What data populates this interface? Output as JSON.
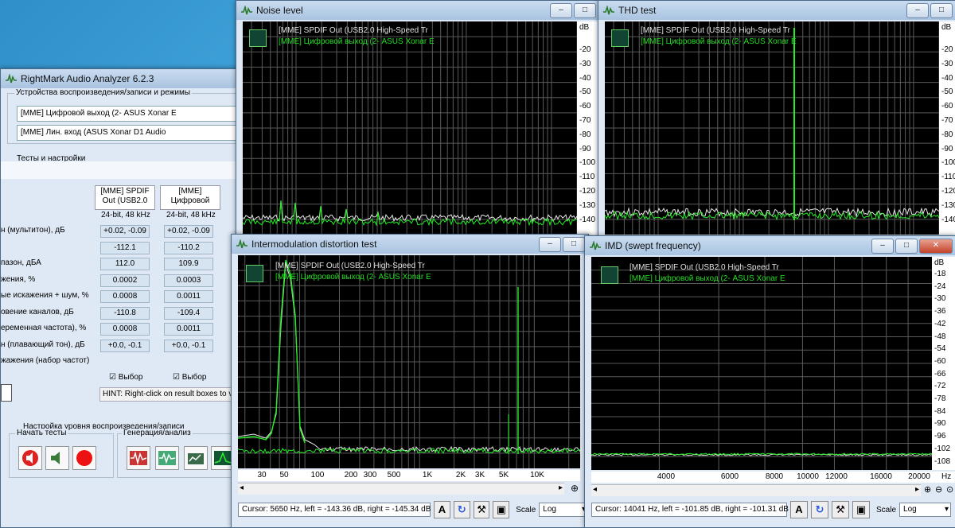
{
  "main": {
    "title": "RightMark Audio Analyzer 6.2.3",
    "devices_group": "Устройства воспроизведения/записи и режимы",
    "device_play": "[MME] Цифровой выход (2- ASUS Xonar E",
    "device_rec": "[MME] Лин. вход (ASUS Xonar D1 Audio",
    "tests_group": "Тесты и настройки",
    "col1_header": "[MME] SPDIF Out (USB2.0",
    "col2_header": "[MME] Цифровой",
    "col1_fmt": "24-bit, 48 kHz",
    "col2_fmt": "24-bit, 48 kHz",
    "rows": [
      {
        "label": "н (мультитон), дБ",
        "v1": "+0.02, -0.09",
        "v2": "+0.02, -0.09"
      },
      {
        "label": "",
        "v1": "-112.1",
        "v2": "-110.2"
      },
      {
        "label": "пазон, дБА",
        "v1": "112.0",
        "v2": "109.9"
      },
      {
        "label": "жения, %",
        "v1": "0.0002",
        "v2": "0.0003"
      },
      {
        "label": "ые искажения + шум, %",
        "v1": "0.0008",
        "v2": "0.0011"
      },
      {
        "label": "овение каналов, дБ",
        "v1": "-110.8",
        "v2": "-109.4"
      },
      {
        "label": "еременная частота), %",
        "v1": "0.0008",
        "v2": "0.0011"
      },
      {
        "label": "н (плавающий тон), дБ",
        "v1": "+0.0, -0.1",
        "v2": "+0.0, -0.1"
      },
      {
        "label": "жажения (набор частот)",
        "v1": "",
        "v2": ""
      }
    ],
    "select_label": "Выбор",
    "hint": "HINT: Right-click on result boxes to vi",
    "level_setup": "Настройка уровня воспроизведения/записи",
    "start_group": "Начать тесты",
    "gen_group": "Генерация/анализ"
  },
  "legend_line1": "[MME] SPDIF Out (USB2.0 High-Speed Tr",
  "legend_line2": "[MME] Цифровой выход (2- ASUS Xonar E",
  "noise": {
    "title": "Noise level",
    "db_label": "dB",
    "db_ticks": [
      "-20",
      "-30",
      "-40",
      "-50",
      "-60",
      "-70",
      "-80",
      "-90",
      "-100",
      "-110",
      "-120",
      "-130",
      "-140"
    ]
  },
  "thd": {
    "title": "THD test",
    "db_label": "dB",
    "db_ticks": [
      "-20",
      "-30",
      "-40",
      "-50",
      "-60",
      "-70",
      "-80",
      "-90",
      "-100",
      "-110",
      "-120",
      "-130",
      "-140"
    ]
  },
  "imd": {
    "title": "Intermodulation distortion test",
    "x_ticks": [
      "30",
      "50",
      "100",
      "200",
      "300",
      "500",
      "1K",
      "2K",
      "3K",
      "5K",
      "10K"
    ],
    "cursor": "Cursor:  5650 Hz,  left = -143.36 dB,  right = -145.34 dB",
    "scale_label": "Scale",
    "scale_value": "Log"
  },
  "swept": {
    "title": "IMD (swept frequency)",
    "db_label": "dB",
    "db_ticks": [
      "-18",
      "-24",
      "-30",
      "-36",
      "-42",
      "-48",
      "-54",
      "-60",
      "-66",
      "-72",
      "-78",
      "-84",
      "-90",
      "-96",
      "-102",
      "-108"
    ],
    "x_ticks": [
      "4000",
      "6000",
      "8000",
      "10000",
      "12000",
      "16000",
      "20000"
    ],
    "hz_label": "Hz",
    "cursor": "Cursor:  14041 Hz,  left = -101.85 dB,  right = -101.31 dB",
    "scale_label": "Scale",
    "scale_value": "Log"
  },
  "colors": {
    "trace_white": "#e8e8e8",
    "trace_green": "#22ee22",
    "grid": "#5a5a5a"
  }
}
